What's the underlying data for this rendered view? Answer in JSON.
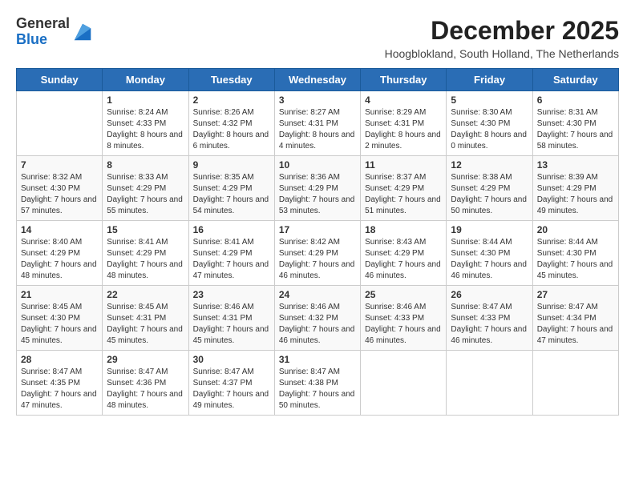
{
  "header": {
    "logo_general": "General",
    "logo_blue": "Blue",
    "title": "December 2025",
    "subtitle": "Hoogblokland, South Holland, The Netherlands"
  },
  "columns": [
    "Sunday",
    "Monday",
    "Tuesday",
    "Wednesday",
    "Thursday",
    "Friday",
    "Saturday"
  ],
  "weeks": [
    [
      {
        "day": "",
        "sunrise": "",
        "sunset": "",
        "daylight": ""
      },
      {
        "day": "1",
        "sunrise": "Sunrise: 8:24 AM",
        "sunset": "Sunset: 4:33 PM",
        "daylight": "Daylight: 8 hours and 8 minutes."
      },
      {
        "day": "2",
        "sunrise": "Sunrise: 8:26 AM",
        "sunset": "Sunset: 4:32 PM",
        "daylight": "Daylight: 8 hours and 6 minutes."
      },
      {
        "day": "3",
        "sunrise": "Sunrise: 8:27 AM",
        "sunset": "Sunset: 4:31 PM",
        "daylight": "Daylight: 8 hours and 4 minutes."
      },
      {
        "day": "4",
        "sunrise": "Sunrise: 8:29 AM",
        "sunset": "Sunset: 4:31 PM",
        "daylight": "Daylight: 8 hours and 2 minutes."
      },
      {
        "day": "5",
        "sunrise": "Sunrise: 8:30 AM",
        "sunset": "Sunset: 4:30 PM",
        "daylight": "Daylight: 8 hours and 0 minutes."
      },
      {
        "day": "6",
        "sunrise": "Sunrise: 8:31 AM",
        "sunset": "Sunset: 4:30 PM",
        "daylight": "Daylight: 7 hours and 58 minutes."
      }
    ],
    [
      {
        "day": "7",
        "sunrise": "Sunrise: 8:32 AM",
        "sunset": "Sunset: 4:30 PM",
        "daylight": "Daylight: 7 hours and 57 minutes."
      },
      {
        "day": "8",
        "sunrise": "Sunrise: 8:33 AM",
        "sunset": "Sunset: 4:29 PM",
        "daylight": "Daylight: 7 hours and 55 minutes."
      },
      {
        "day": "9",
        "sunrise": "Sunrise: 8:35 AM",
        "sunset": "Sunset: 4:29 PM",
        "daylight": "Daylight: 7 hours and 54 minutes."
      },
      {
        "day": "10",
        "sunrise": "Sunrise: 8:36 AM",
        "sunset": "Sunset: 4:29 PM",
        "daylight": "Daylight: 7 hours and 53 minutes."
      },
      {
        "day": "11",
        "sunrise": "Sunrise: 8:37 AM",
        "sunset": "Sunset: 4:29 PM",
        "daylight": "Daylight: 7 hours and 51 minutes."
      },
      {
        "day": "12",
        "sunrise": "Sunrise: 8:38 AM",
        "sunset": "Sunset: 4:29 PM",
        "daylight": "Daylight: 7 hours and 50 minutes."
      },
      {
        "day": "13",
        "sunrise": "Sunrise: 8:39 AM",
        "sunset": "Sunset: 4:29 PM",
        "daylight": "Daylight: 7 hours and 49 minutes."
      }
    ],
    [
      {
        "day": "14",
        "sunrise": "Sunrise: 8:40 AM",
        "sunset": "Sunset: 4:29 PM",
        "daylight": "Daylight: 7 hours and 48 minutes."
      },
      {
        "day": "15",
        "sunrise": "Sunrise: 8:41 AM",
        "sunset": "Sunset: 4:29 PM",
        "daylight": "Daylight: 7 hours and 48 minutes."
      },
      {
        "day": "16",
        "sunrise": "Sunrise: 8:41 AM",
        "sunset": "Sunset: 4:29 PM",
        "daylight": "Daylight: 7 hours and 47 minutes."
      },
      {
        "day": "17",
        "sunrise": "Sunrise: 8:42 AM",
        "sunset": "Sunset: 4:29 PM",
        "daylight": "Daylight: 7 hours and 46 minutes."
      },
      {
        "day": "18",
        "sunrise": "Sunrise: 8:43 AM",
        "sunset": "Sunset: 4:29 PM",
        "daylight": "Daylight: 7 hours and 46 minutes."
      },
      {
        "day": "19",
        "sunrise": "Sunrise: 8:44 AM",
        "sunset": "Sunset: 4:30 PM",
        "daylight": "Daylight: 7 hours and 46 minutes."
      },
      {
        "day": "20",
        "sunrise": "Sunrise: 8:44 AM",
        "sunset": "Sunset: 4:30 PM",
        "daylight": "Daylight: 7 hours and 45 minutes."
      }
    ],
    [
      {
        "day": "21",
        "sunrise": "Sunrise: 8:45 AM",
        "sunset": "Sunset: 4:30 PM",
        "daylight": "Daylight: 7 hours and 45 minutes."
      },
      {
        "day": "22",
        "sunrise": "Sunrise: 8:45 AM",
        "sunset": "Sunset: 4:31 PM",
        "daylight": "Daylight: 7 hours and 45 minutes."
      },
      {
        "day": "23",
        "sunrise": "Sunrise: 8:46 AM",
        "sunset": "Sunset: 4:31 PM",
        "daylight": "Daylight: 7 hours and 45 minutes."
      },
      {
        "day": "24",
        "sunrise": "Sunrise: 8:46 AM",
        "sunset": "Sunset: 4:32 PM",
        "daylight": "Daylight: 7 hours and 46 minutes."
      },
      {
        "day": "25",
        "sunrise": "Sunrise: 8:46 AM",
        "sunset": "Sunset: 4:33 PM",
        "daylight": "Daylight: 7 hours and 46 minutes."
      },
      {
        "day": "26",
        "sunrise": "Sunrise: 8:47 AM",
        "sunset": "Sunset: 4:33 PM",
        "daylight": "Daylight: 7 hours and 46 minutes."
      },
      {
        "day": "27",
        "sunrise": "Sunrise: 8:47 AM",
        "sunset": "Sunset: 4:34 PM",
        "daylight": "Daylight: 7 hours and 47 minutes."
      }
    ],
    [
      {
        "day": "28",
        "sunrise": "Sunrise: 8:47 AM",
        "sunset": "Sunset: 4:35 PM",
        "daylight": "Daylight: 7 hours and 47 minutes."
      },
      {
        "day": "29",
        "sunrise": "Sunrise: 8:47 AM",
        "sunset": "Sunset: 4:36 PM",
        "daylight": "Daylight: 7 hours and 48 minutes."
      },
      {
        "day": "30",
        "sunrise": "Sunrise: 8:47 AM",
        "sunset": "Sunset: 4:37 PM",
        "daylight": "Daylight: 7 hours and 49 minutes."
      },
      {
        "day": "31",
        "sunrise": "Sunrise: 8:47 AM",
        "sunset": "Sunset: 4:38 PM",
        "daylight": "Daylight: 7 hours and 50 minutes."
      },
      {
        "day": "",
        "sunrise": "",
        "sunset": "",
        "daylight": ""
      },
      {
        "day": "",
        "sunrise": "",
        "sunset": "",
        "daylight": ""
      },
      {
        "day": "",
        "sunrise": "",
        "sunset": "",
        "daylight": ""
      }
    ]
  ]
}
